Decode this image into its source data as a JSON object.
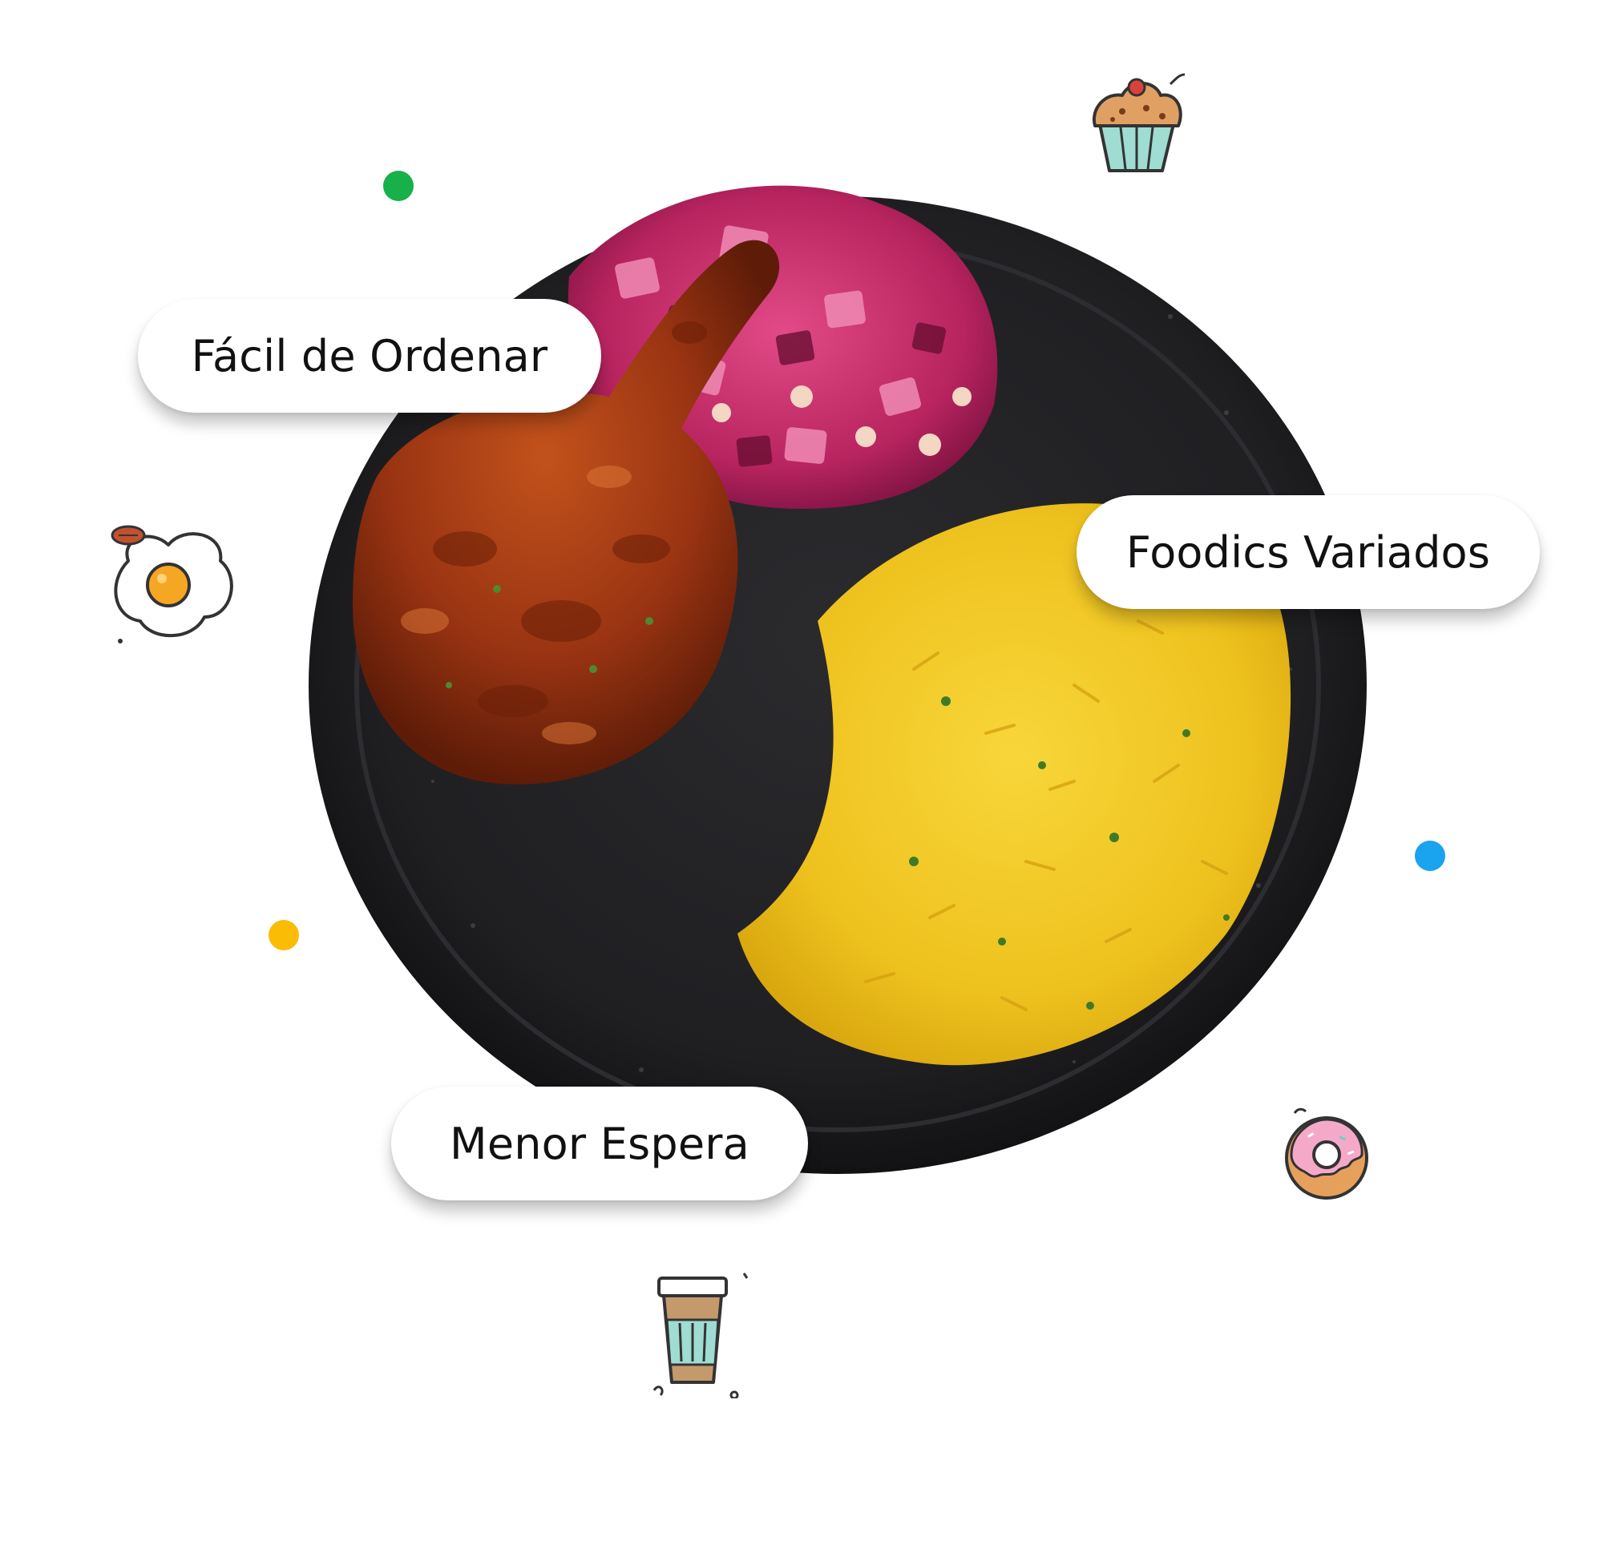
{
  "labels": {
    "easy_order": "Fácil de Ordenar",
    "varied_foodics": "Foodics Variados",
    "less_wait": "Menor Espera"
  },
  "icons": [
    "cupcake-icon",
    "fried-egg-icon",
    "donut-icon",
    "coffee-cup-icon"
  ],
  "colors": {
    "dot_green": "#17b04a",
    "dot_yellow": "#fbbc05",
    "dot_blue": "#1aa3ef",
    "plate": "#1e1e20",
    "pill_background": "#ffffff"
  }
}
